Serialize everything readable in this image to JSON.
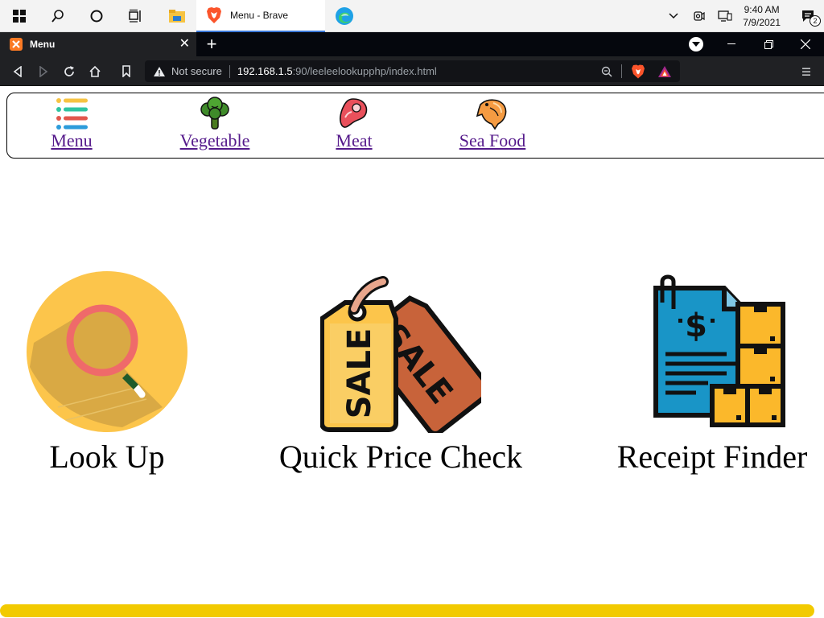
{
  "taskbar": {
    "clock_time": "9:40 AM",
    "clock_date": "7/9/2021",
    "notification_count": "2",
    "active_app_title": "Menu - Brave"
  },
  "browser": {
    "tab_title": "Menu",
    "url_warning": "Not secure",
    "url_host": "192.168.1.5",
    "url_rest": ":90/leeleelookupphp/index.html"
  },
  "nav": {
    "items": [
      {
        "label": "Menu",
        "icon": "menu-list-icon"
      },
      {
        "label": "Vegetable",
        "icon": "broccoli-icon"
      },
      {
        "label": "Meat",
        "icon": "steak-icon"
      },
      {
        "label": "Sea Food",
        "icon": "fish-icon"
      }
    ]
  },
  "tiles": [
    {
      "label": "Look Up",
      "icon": "magnifier-icon"
    },
    {
      "label": "Quick Price Check",
      "icon": "sale-tag-icon"
    },
    {
      "label": "Receipt Finder",
      "icon": "receipt-boxes-icon"
    }
  ],
  "colors": {
    "scroll_thumb": "#f2ca00",
    "link": "#551a8b",
    "taskbar_accent": "#3b78d8"
  }
}
